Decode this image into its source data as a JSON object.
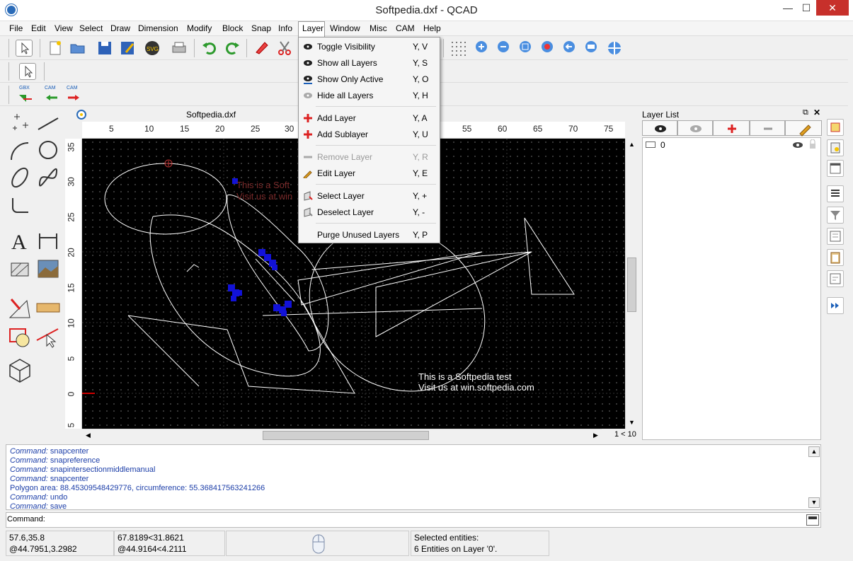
{
  "window": {
    "title": "Softpedia.dxf - QCAD",
    "min": "—",
    "max": "☐",
    "close": "✕"
  },
  "menubar": [
    "File",
    "Edit",
    "View",
    "Select",
    "Draw",
    "Dimension",
    "Modify",
    "Block",
    "Snap",
    "Info",
    "Layer",
    "Window",
    "Misc",
    "CAM",
    "Help"
  ],
  "toolbar3": {
    "gbx": "GBX",
    "cam1": "CAM",
    "cam2": "CAM"
  },
  "document": {
    "title": "Softpedia.dxf"
  },
  "ruler_top": [
    "5",
    "10",
    "15",
    "20",
    "25",
    "30",
    "55",
    "60",
    "65",
    "70",
    "75"
  ],
  "ruler_left": [
    "35",
    "30",
    "25",
    "20",
    "15",
    "10",
    "5",
    "0",
    "5"
  ],
  "drawing_text": {
    "line1": "This is a Softpedia test",
    "line2": "Visit us at win.softpedia.com",
    "ghost1": "This is a Soft",
    "ghost2": "Visit us at win"
  },
  "layer_menu": [
    {
      "label": "Toggle Visibility",
      "shortcut": "Y, V",
      "icon": "eye-toggle-icon"
    },
    {
      "label": "Show all Layers",
      "shortcut": "Y, S",
      "icon": "eye-icon"
    },
    {
      "label": "Show Only Active",
      "shortcut": "Y, O",
      "icon": "eye-active-icon"
    },
    {
      "label": "Hide all Layers",
      "shortcut": "Y, H",
      "icon": "eye-hidden-icon"
    },
    {
      "label": "Add Layer",
      "shortcut": "Y, A",
      "icon": "plus-icon"
    },
    {
      "label": "Add Sublayer",
      "shortcut": "Y, U",
      "icon": "plus-icon"
    },
    {
      "label": "Remove Layer",
      "shortcut": "Y, R",
      "icon": "minus-icon",
      "disabled": true
    },
    {
      "label": "Edit Layer",
      "shortcut": "Y, E",
      "icon": "pencil-icon"
    },
    {
      "label": "Select Layer",
      "shortcut": "Y, +",
      "icon": "select-layer-icon"
    },
    {
      "label": "Deselect Layer",
      "shortcut": "Y, -",
      "icon": "deselect-layer-icon"
    },
    {
      "label": "Purge Unused Layers",
      "shortcut": "Y, P",
      "icon": ""
    }
  ],
  "layer_panel": {
    "title": "Layer List",
    "layers": [
      {
        "name": "0"
      }
    ]
  },
  "scroll_info": "1 < 10",
  "command_history": [
    {
      "prefix": "Command:",
      "text": "snapcenter"
    },
    {
      "prefix": "Command:",
      "text": "snapreference"
    },
    {
      "prefix": "Command:",
      "text": "snapintersectionmiddlemanual"
    },
    {
      "prefix": "Command:",
      "text": "snapcenter"
    },
    {
      "prefix": "",
      "text": "Polygon area: 88.45309548429776, circumference: 55.368417563241266"
    },
    {
      "prefix": "Command:",
      "text": "undo"
    },
    {
      "prefix": "Command:",
      "text": "save"
    }
  ],
  "command_label": "Command:",
  "status": {
    "abs1": "57.6,35.8",
    "rel1": "@44.7951,3.2982",
    "abs2": "67.8189<31.8621",
    "rel2": "@44.9164<4.2111",
    "sel_title": "Selected entities:",
    "sel_text": "6 Entities on Layer '0'."
  },
  "colors": {
    "canvas": "#000000",
    "entities": "#ffffff",
    "selected": "#0000ff",
    "accent": "#2a6bb8"
  }
}
